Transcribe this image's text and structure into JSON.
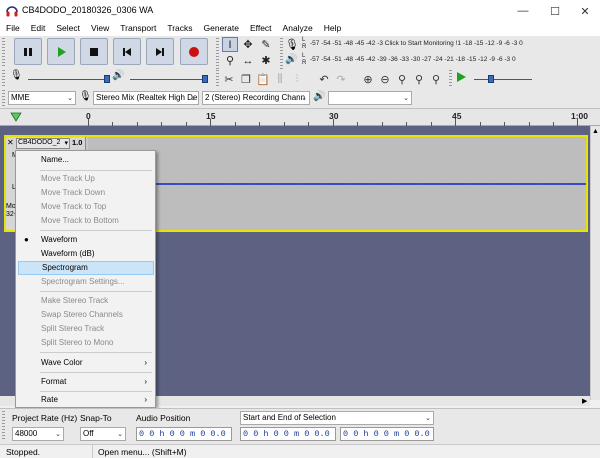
{
  "window": {
    "title": "CB4DODO_20180326_0306 WA",
    "minimize": "—",
    "maximize": "☐",
    "close": "✕"
  },
  "menu": [
    "File",
    "Edit",
    "Select",
    "View",
    "Transport",
    "Tracks",
    "Generate",
    "Effect",
    "Analyze",
    "Help"
  ],
  "meters": {
    "record_scale": "-57 -54 -51 -48 -45 -42 -3 Click to Start Monitoring !1 -18 -15 -12 -9 -6 -3 0",
    "play_scale": "-57 -54 -51 -48 -45 -42 -39 -36 -33 -30 -27 -24 -21 -18 -15 -12 -9 -6 -3 0",
    "l": "L",
    "r": "R"
  },
  "device": {
    "host": "MME",
    "input": "Stereo Mix (Realtek High De",
    "channels": "2 (Stereo) Recording Chann",
    "output": ""
  },
  "timeline": {
    "labels": [
      "0",
      "15",
      "30",
      "45",
      "1:00"
    ]
  },
  "track": {
    "name": "CB4DODO_2",
    "gain_label": "1.0",
    "close": "✕",
    "info_line1": "Mor",
    "info_line2": "32-",
    "mute_initial": "M",
    "l_label": "L"
  },
  "context_menu": {
    "items": [
      {
        "label": "Name...",
        "enabled": true
      },
      {
        "label": "Move Track Up",
        "enabled": false
      },
      {
        "label": "Move Track Down",
        "enabled": false
      },
      {
        "label": "Move Track to Top",
        "enabled": false
      },
      {
        "label": "Move Track to Bottom",
        "enabled": false
      },
      {
        "label": "Waveform",
        "enabled": true,
        "checked": true
      },
      {
        "label": "Waveform (dB)",
        "enabled": true
      },
      {
        "label": "Spectrogram",
        "enabled": true,
        "highlighted": true
      },
      {
        "label": "Spectrogram Settings...",
        "enabled": false
      },
      {
        "label": "Make Stereo Track",
        "enabled": false
      },
      {
        "label": "Swap Stereo Channels",
        "enabled": false
      },
      {
        "label": "Split Stereo Track",
        "enabled": false
      },
      {
        "label": "Split Stereo to Mono",
        "enabled": false
      },
      {
        "label": "Wave Color",
        "enabled": true,
        "submenu": true
      },
      {
        "label": "Format",
        "enabled": true,
        "submenu": true
      },
      {
        "label": "Rate",
        "enabled": true,
        "submenu": true
      }
    ]
  },
  "selection_toolbar": {
    "project_rate_label": "Project Rate (Hz)",
    "project_rate_value": "48000",
    "snap_to_label": "Snap-To",
    "snap_to_value": "Off",
    "audio_position_label": "Audio Position",
    "audio_position_value": "0 0 h 0 0 m 0 0.0 0 0 s",
    "selection_mode": "Start and End of Selection",
    "sel_start": "0 0 h 0 0 m 0 0.0 0 0 s",
    "sel_end": "0 0 h 0 0 m 0 0.0 0 0 s"
  },
  "status": {
    "state": "Stopped.",
    "hint": "Open menu... (Shift+M)"
  },
  "colors": {
    "track_bg": "#5d6283",
    "wave_color": "#3a4ec8",
    "selection_border": "#e8e400",
    "menu_highlight": "#cce4f7",
    "record_red": "#cc1010",
    "play_green": "#22a022"
  }
}
